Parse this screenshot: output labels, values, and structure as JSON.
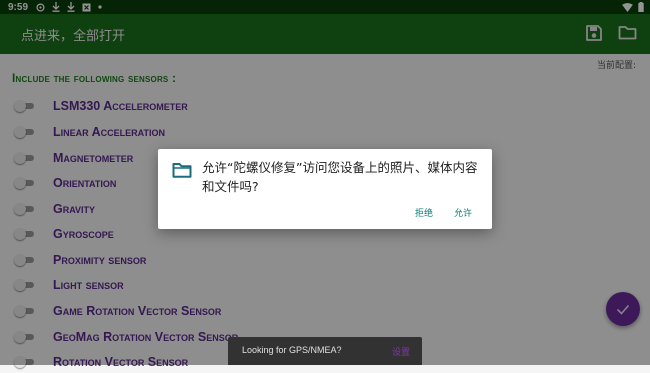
{
  "status_bar": {
    "time": "9:59",
    "icons": [
      "settings-icon",
      "download-icon",
      "download-icon",
      "media-icon",
      "dot-icon"
    ],
    "right_icons": [
      "wifi-icon",
      "battery-icon"
    ]
  },
  "toolbar": {
    "title": "点进来，全部打开",
    "save_icon": "save-icon",
    "folder_icon": "folder-icon",
    "background": "#1b6e1b"
  },
  "current_config_label": "当前配置:",
  "include_label": "Include the following sensors :",
  "sensors": [
    {
      "label": "LSM330 Accelerometer",
      "enabled": false
    },
    {
      "label": "Linear Acceleration",
      "enabled": false
    },
    {
      "label": "Magnetometer",
      "enabled": false
    },
    {
      "label": "Orientation",
      "enabled": false
    },
    {
      "label": "Gravity",
      "enabled": false
    },
    {
      "label": "Gyroscope",
      "enabled": false
    },
    {
      "label": "Proximity sensor",
      "enabled": false
    },
    {
      "label": "Light sensor",
      "enabled": false
    },
    {
      "label": "Game Rotation Vector Sensor",
      "enabled": false
    },
    {
      "label": "GeoMag Rotation Vector Sensor",
      "enabled": false
    },
    {
      "label": "Rotation Vector Sensor",
      "enabled": false
    }
  ],
  "dialog": {
    "icon": "folder-icon",
    "message": "允许“陀螺仪修复”访问您设备上的照片、媒体内容和文件吗?",
    "deny_label": "拒绝",
    "allow_label": "允许"
  },
  "fab": {
    "icon": "check-icon",
    "color": "#6a2c9a"
  },
  "snackbar": {
    "text": "Looking for GPS/NMEA?",
    "action": "设置"
  }
}
